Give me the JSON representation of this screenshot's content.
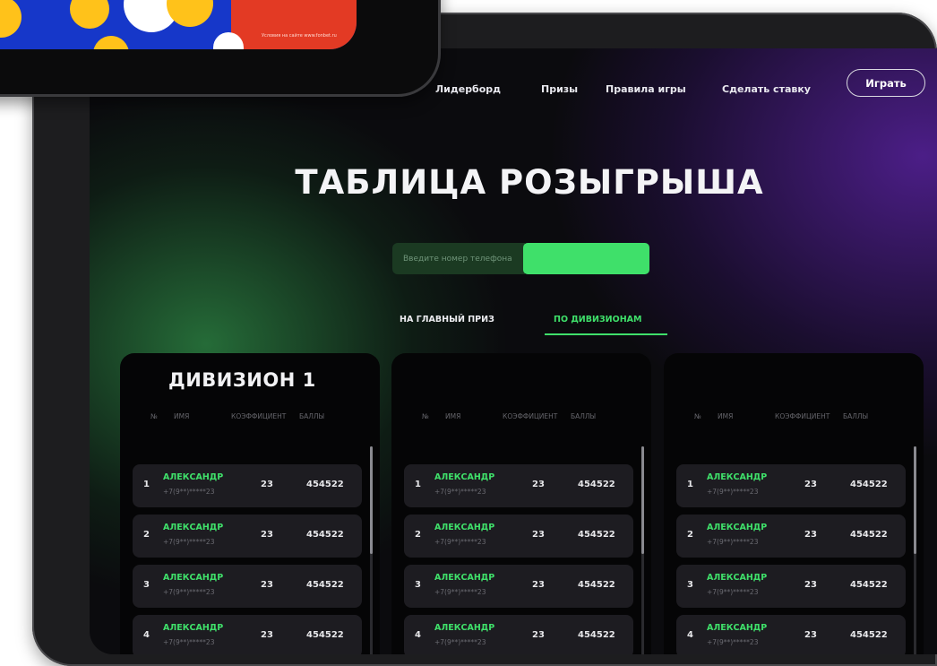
{
  "nav": {
    "links": [
      "Лидерборд",
      "Призы",
      "Правила игры",
      "Сделать ставку"
    ],
    "play_button": "Играть"
  },
  "page_title": "ТАБЛИЦА РОЗЫГРЫША",
  "search": {
    "placeholder": "Введите номер телефона",
    "button": ""
  },
  "tabs": [
    {
      "label": "НА ГЛАВНЫЙ ПРИЗ",
      "active": false
    },
    {
      "label": "ПО ДИВИЗИОНАМ",
      "active": true
    }
  ],
  "divisions": [
    {
      "title": "ДИВИЗИОН 1"
    },
    {
      "title": ""
    },
    {
      "title": ""
    }
  ],
  "table_headers": {
    "num": "№",
    "name": "ИМЯ",
    "coef": "КОЭФФИЦИЕНТ",
    "points": "БАЛЛЫ"
  },
  "rows": [
    {
      "num": "1",
      "name": "АЛЕКСАНДР",
      "phone": "+7(9**)*****23",
      "coef": "23",
      "points": "454522"
    },
    {
      "num": "2",
      "name": "АЛЕКСАНДР",
      "phone": "+7(9**)*****23",
      "coef": "23",
      "points": "454522"
    },
    {
      "num": "3",
      "name": "АЛЕКСАНДР",
      "phone": "+7(9**)*****23",
      "coef": "23",
      "points": "454522"
    },
    {
      "num": "4",
      "name": "АЛЕКСАНДР",
      "phone": "+7(9**)*****23",
      "coef": "23",
      "points": "454522"
    }
  ],
  "phone_overlay": {
    "small_text": "Условия на сайте www.fonbet.ru"
  },
  "colors": {
    "accent": "#3fe06a",
    "background": "#0b0b0e",
    "card": "#050506",
    "row": "#1d1c21"
  }
}
